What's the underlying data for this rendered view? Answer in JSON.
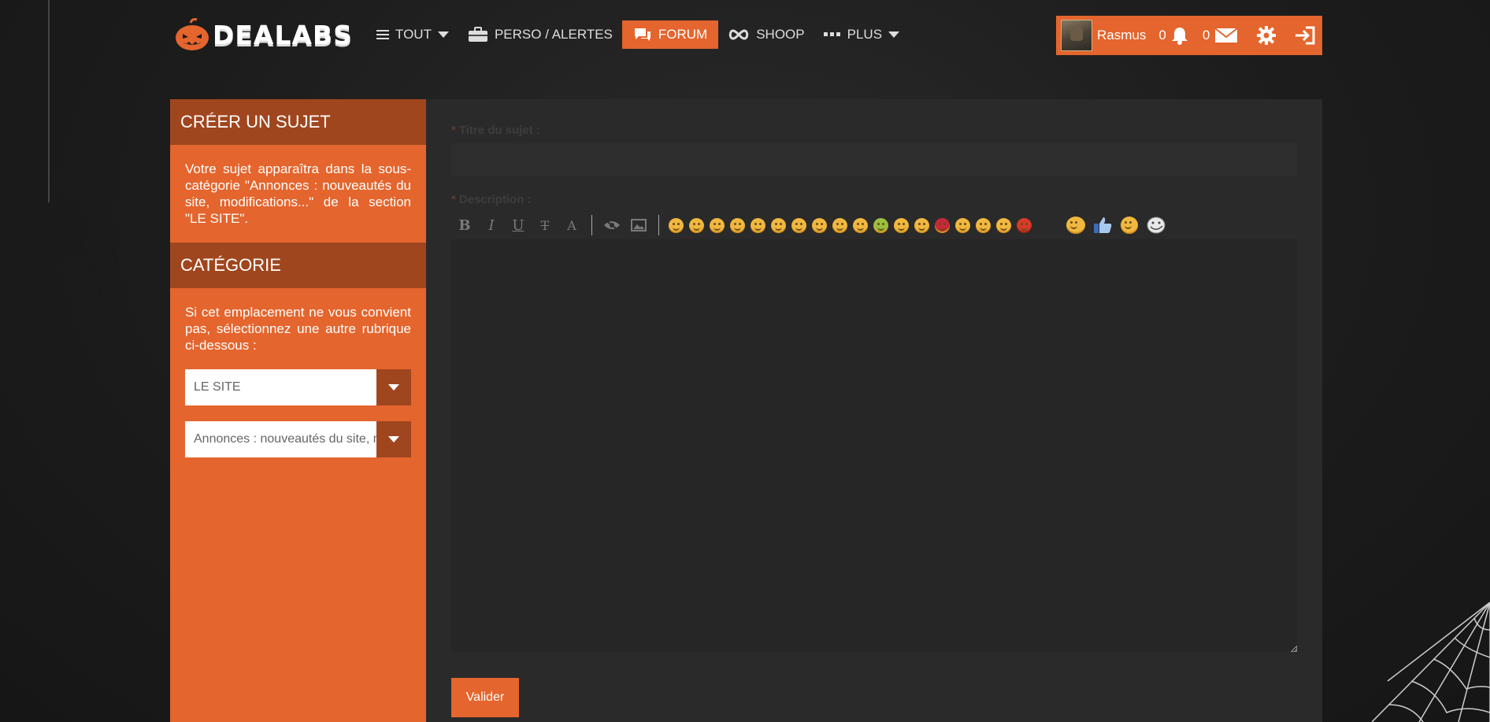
{
  "header": {
    "logo_text": "DEALABS",
    "nav": {
      "tout": "TOUT",
      "perso": "PERSO / ALERTES",
      "forum": "FORUM",
      "shoop": "SHOOP",
      "plus": "PLUS"
    },
    "user": {
      "name": "Rasmus",
      "notifications": "0",
      "messages": "0"
    }
  },
  "sidebar": {
    "create_title": "CRÉER UN SUJET",
    "create_text": "Votre sujet apparaîtra dans la sous-catégorie \"Annonces : nouveautés du site, modifications...\" de la section \"LE SITE\".",
    "category_title": "CATÉGORIE",
    "category_text": "Si cet emplacement ne vous convient pas, sélectionnez une autre rubrique ci-dessous :",
    "select_section": "LE SITE",
    "select_subcategory": "Annonces : nouveautés du site, modifications..."
  },
  "form": {
    "required_mark": "*",
    "title_label": "Titre du sujet :",
    "description_label": "Description :",
    "toolbar": {
      "bold": "B",
      "italic": "I",
      "underline": "U",
      "strike": "T",
      "size": "A"
    },
    "submit_label": "Valider"
  },
  "colors": {
    "accent": "#e4652d",
    "accent_dark": "#a0461e",
    "panel": "#2a2a2a",
    "background": "#1c1c1c"
  }
}
